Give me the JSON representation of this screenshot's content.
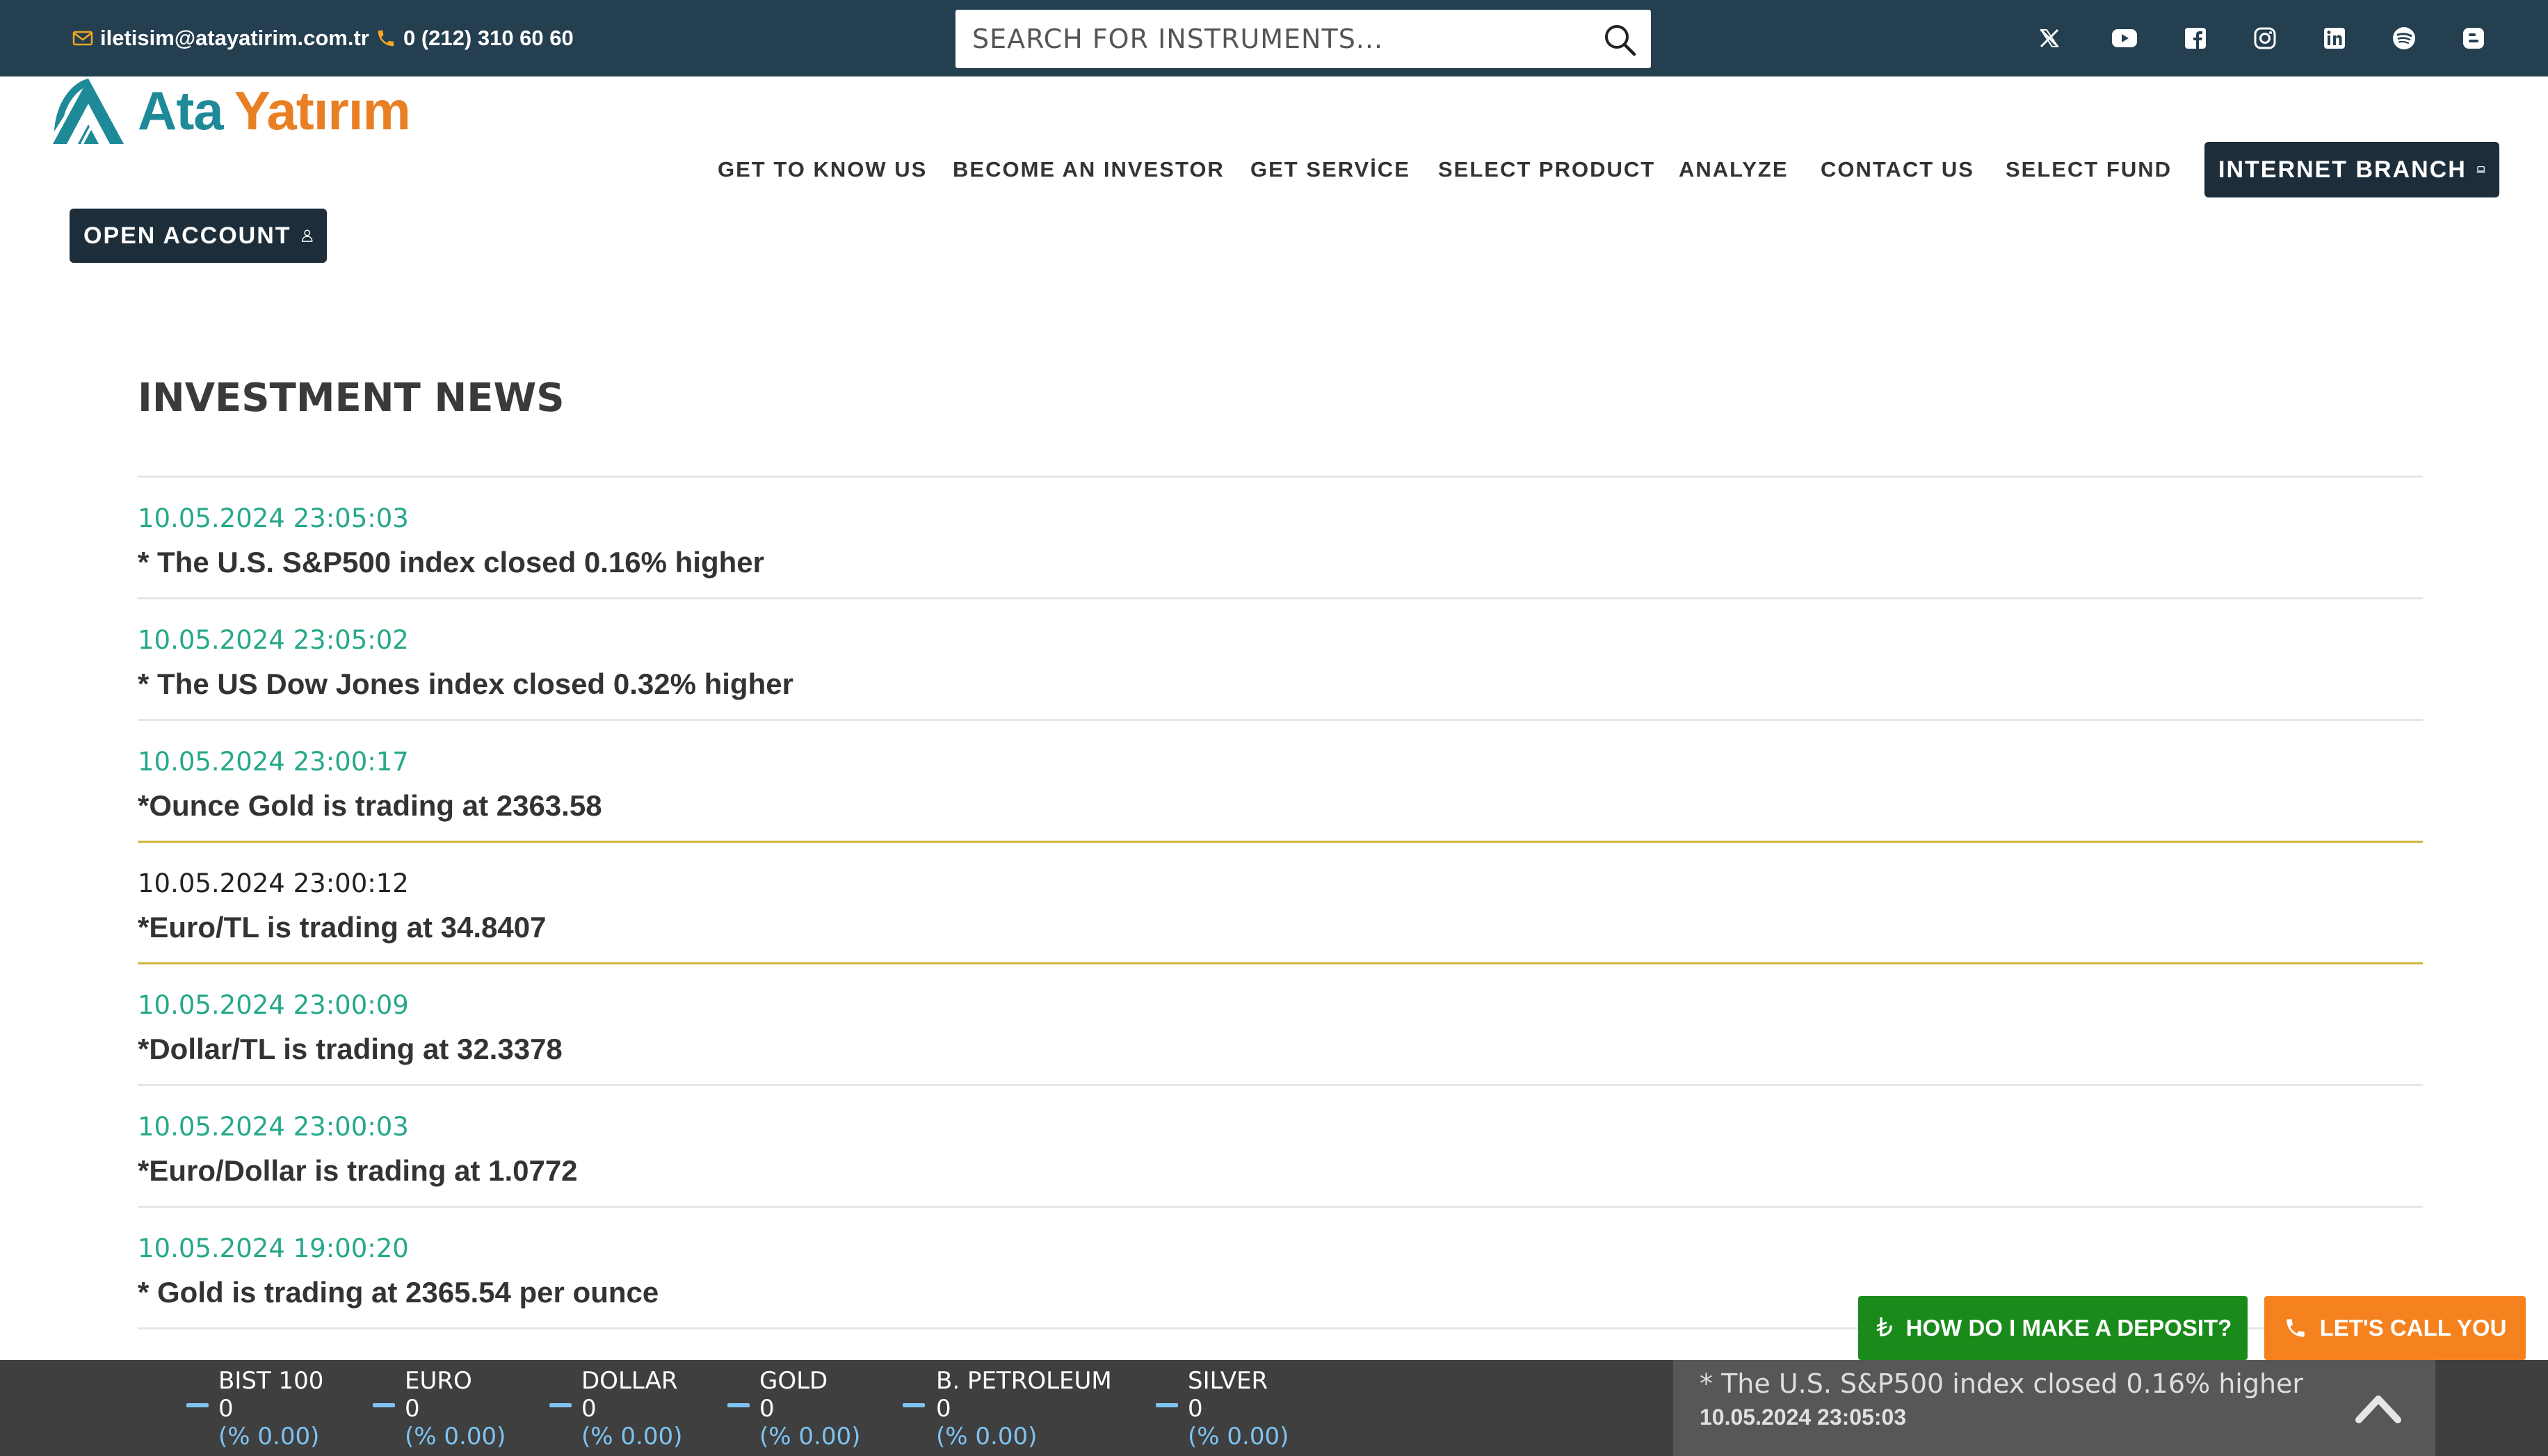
{
  "topbar": {
    "email": "iletisim@atayatirim.com.tr",
    "phone": "0 (212) 310 60 60",
    "search_placeholder": "SEARCH FOR INSTRUMENTS...",
    "social": [
      "x-icon",
      "youtube-icon",
      "facebook-icon",
      "instagram-icon",
      "linkedin-icon",
      "spotify-icon",
      "blogger-icon"
    ]
  },
  "logo": {
    "part1": "Ata",
    "part2": "Yatırım"
  },
  "nav": {
    "items": [
      "GET TO KNOW US",
      "BECOME AN INVESTOR",
      "GET SERVİCE",
      "SELECT PRODUCT",
      "ANALYZE",
      "CONTACT US",
      "SELECT FUND"
    ],
    "internet_branch": "INTERNET BRANCH",
    "open_account": "OPEN ACCOUNT"
  },
  "page": {
    "title": "INVESTMENT NEWS"
  },
  "news": [
    {
      "time": "10.05.2024 23:05:03",
      "title": "* The U.S. S&P500 index closed 0.16% higher"
    },
    {
      "time": "10.05.2024 23:05:02",
      "title": "* The US Dow Jones index closed 0.32% higher"
    },
    {
      "time": "10.05.2024 23:00:17",
      "title": "*Ounce Gold is trading at 2363.58"
    },
    {
      "time": "10.05.2024 23:00:12",
      "title": "*Euro/TL is trading at 34.8407"
    },
    {
      "time": "10.05.2024 23:00:09",
      "title": "*Dollar/TL is trading at 32.3378"
    },
    {
      "time": "10.05.2024 23:00:03",
      "title": "*Euro/Dollar is trading at 1.0772"
    },
    {
      "time": "10.05.2024 19:00:20",
      "title": "* Gold is trading at 2365.54 per ounce"
    }
  ],
  "cta": {
    "deposit": "HOW DO I MAKE A DEPOSIT?",
    "call": "LET'S CALL YOU",
    "deposit_color": "#1a8a1a",
    "call_color": "#f5821f"
  },
  "tickers": [
    {
      "name": "BIST 100",
      "value": "0",
      "change": "(% 0.00)"
    },
    {
      "name": "EURO",
      "value": "0",
      "change": "(% 0.00)"
    },
    {
      "name": "DOLLAR",
      "value": "0",
      "change": "(% 0.00)"
    },
    {
      "name": "GOLD",
      "value": "0",
      "change": "(% 0.00)"
    },
    {
      "name": "B. PETROLEUM",
      "value": "0",
      "change": "(% 0.00)"
    },
    {
      "name": "SILVER",
      "value": "0",
      "change": "(% 0.00)"
    }
  ],
  "latest": {
    "title": "* The U.S. S&P500 index closed 0.16% higher",
    "time": "10.05.2024 23:05:03"
  },
  "colors": {
    "topbar": "#243f50",
    "accent_green": "#27a88a",
    "active_line": "#d4b53a",
    "logo_teal": "#1e8a97",
    "logo_orange": "#e97f25"
  }
}
